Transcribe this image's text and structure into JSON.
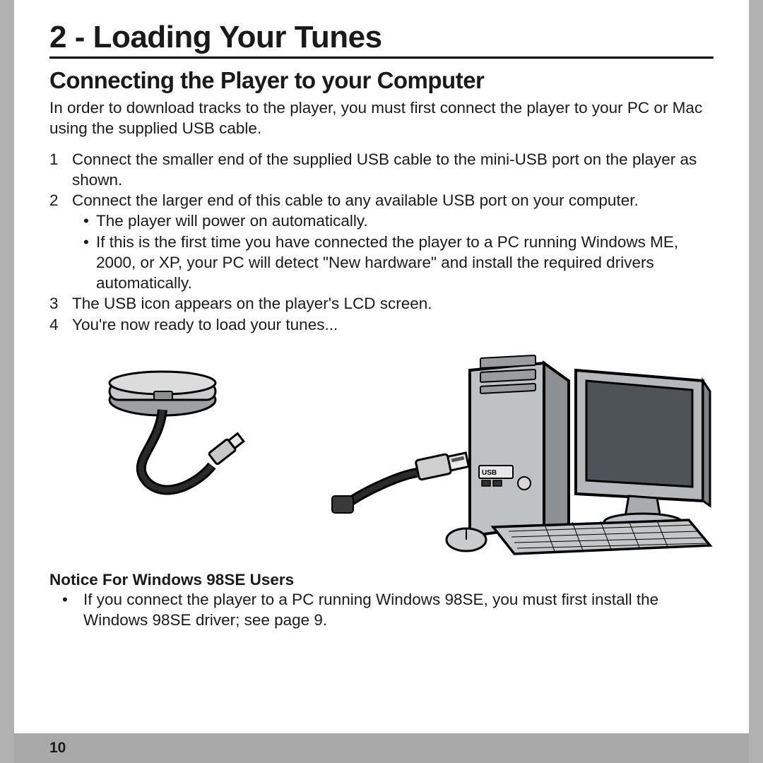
{
  "chapter_title": "2 - Loading Your Tunes",
  "section_title": "Connecting the Player to your Computer",
  "intro": "In order to download tracks to the player, you must first connect the player to your PC or Mac using the supplied USB cable.",
  "steps": [
    {
      "n": "1",
      "text": "Connect the smaller end of the supplied USB cable to the mini-USB port on the player as shown.",
      "bullets": []
    },
    {
      "n": "2",
      "text": "Connect the larger end of this cable to any available USB port on your computer.",
      "bullets": [
        "The player will power on automatically.",
        "If this is the first time you have connected the player to a PC running Windows ME, 2000, or XP, your PC will detect \"New hardware\" and install the required drivers automatically."
      ]
    },
    {
      "n": "3",
      "text": "The USB icon appears on the player's LCD screen.",
      "bullets": []
    },
    {
      "n": "4",
      "text": "You're now ready to load your tunes...",
      "bullets": []
    }
  ],
  "notice_title": "Notice For Windows 98SE Users",
  "notice_items": [
    "If you connect the player to a PC running Windows 98SE, you must first install the Windows 98SE driver; see page 9."
  ],
  "page_number": "10",
  "illus_usb_label": "USB"
}
